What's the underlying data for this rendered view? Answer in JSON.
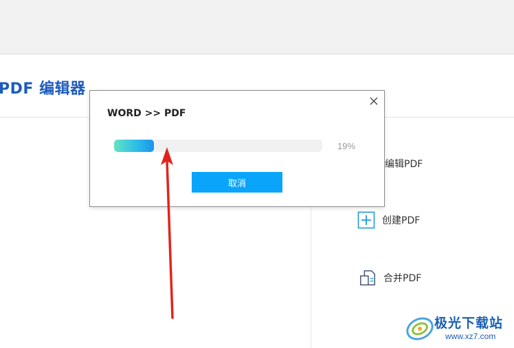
{
  "app": {
    "title": "PDF 编辑器"
  },
  "sidebar": {
    "items": [
      {
        "label": "编辑PDF",
        "icon": "edit-pdf-icon"
      },
      {
        "label": "创建PDF",
        "icon": "plus-box-icon"
      },
      {
        "label": "合并PDF",
        "icon": "merge-pdf-icon"
      }
    ]
  },
  "dialog": {
    "title": "WORD >> PDF",
    "progress": {
      "percent": 19,
      "label": "19%"
    },
    "cancel_label": "取消",
    "close_icon": "close-icon"
  },
  "annotation": {
    "arrow_color": "#e2231a"
  },
  "watermark": {
    "name": "极光下载站",
    "url": "www.xz7.com"
  },
  "colors": {
    "accent": "#0aa5fa",
    "title_blue": "#1d5bbd"
  }
}
